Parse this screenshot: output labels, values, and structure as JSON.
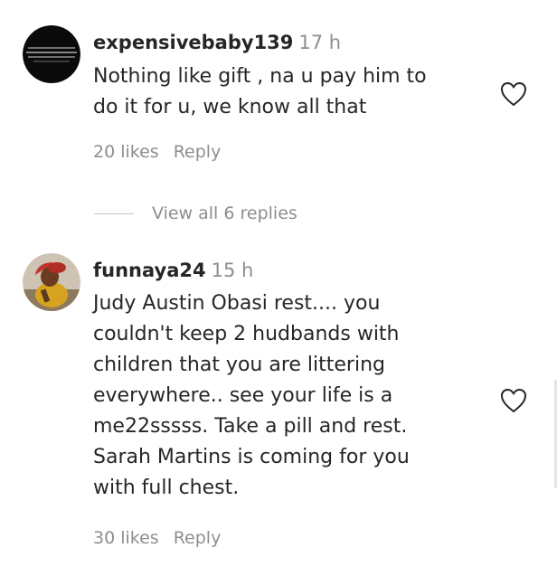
{
  "comments": [
    {
      "username": "expensivebaby139",
      "time": "17 h",
      "lines": [
        "Nothing like gift , na u pay him to",
        "do it for u, we know all that"
      ],
      "likes": "20 likes",
      "reply": "Reply",
      "avatar_icon": "text-image-avatar",
      "heart_icon": "heart-outline-icon"
    },
    {
      "username": "funnaya24",
      "time": "15 h",
      "lines": [
        "Judy Austin Obasi rest.... you",
        "couldn't keep 2 hudbands with",
        "children that you are littering",
        "everywhere.. see your life is a",
        "me22sssss. Take a pill and rest.",
        "Sarah Martins is coming for you",
        "with full chest."
      ],
      "likes": "30 likes",
      "reply": "Reply",
      "avatar_icon": "person-photo-avatar",
      "heart_icon": "heart-outline-icon"
    }
  ],
  "view_replies": "View all 6 replies",
  "colors": {
    "text": "#262626",
    "secondary": "#8e8e8e",
    "divider": "#c7c7c7"
  }
}
